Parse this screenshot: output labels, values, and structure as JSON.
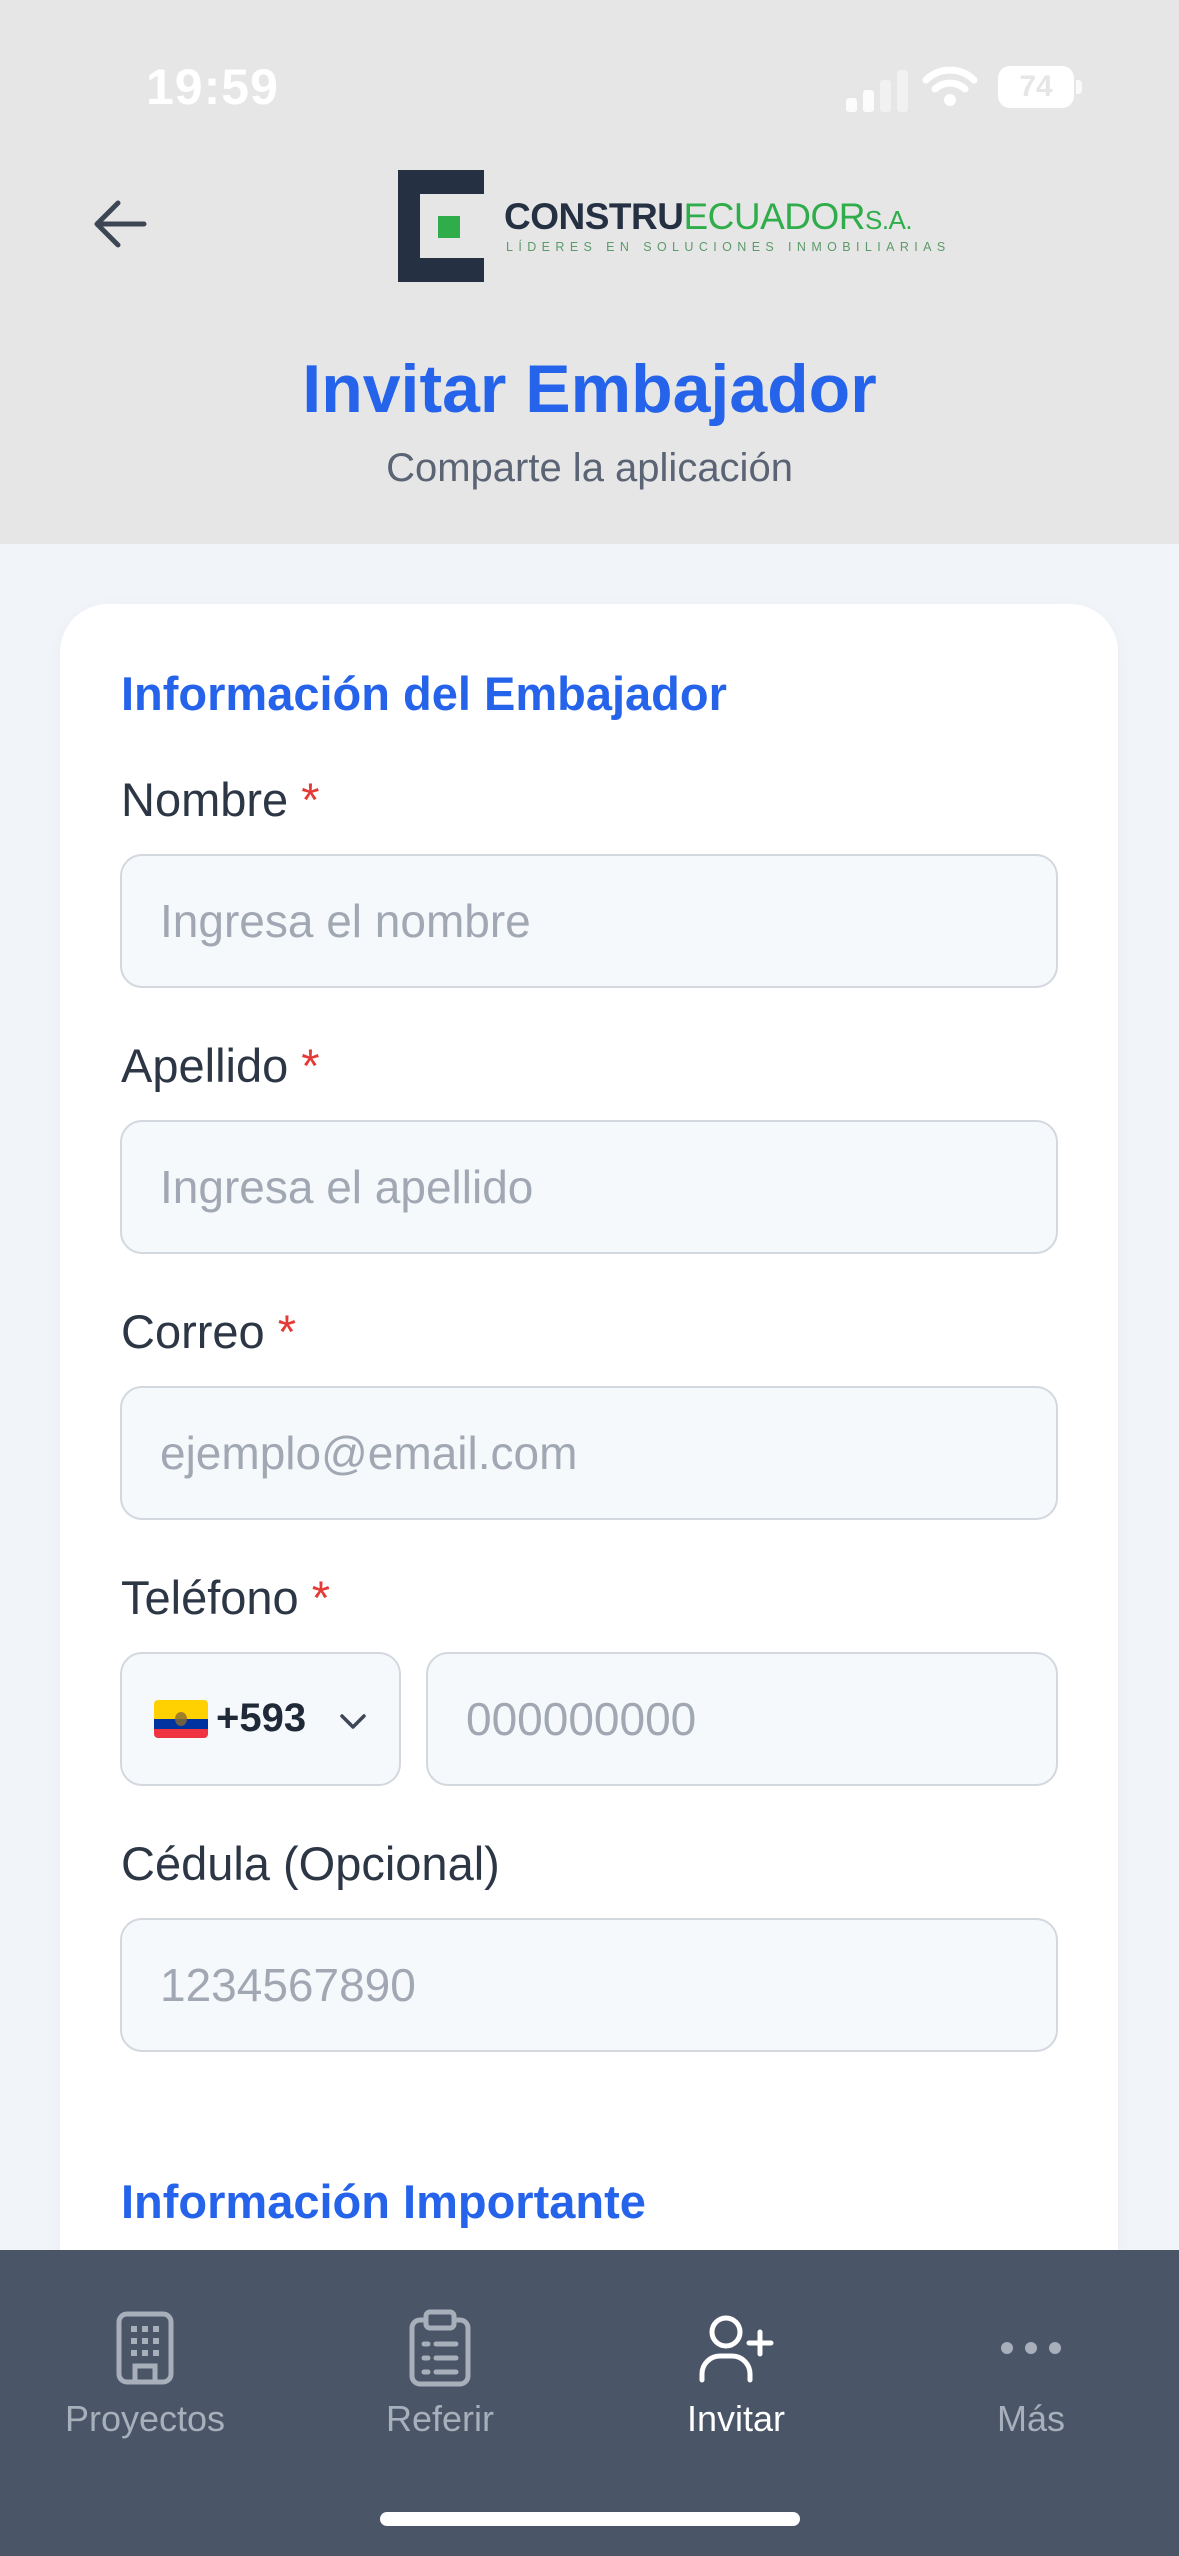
{
  "status_bar": {
    "time": "19:59",
    "battery": "74"
  },
  "header": {
    "back_icon": "arrow-left-icon",
    "logo": {
      "brand_part1": "CONSTRU",
      "brand_part2": "ECUADOR",
      "brand_part3": "S.A.",
      "tagline": "LÍDERES EN SOLUCIONES INMOBILIARIAS"
    },
    "title": "Invitar Embajador",
    "subtitle": "Comparte la aplicación"
  },
  "form": {
    "section_title": "Información del Embajador",
    "required_mark": "*",
    "nombre": {
      "label": "Nombre",
      "placeholder": "Ingresa el nombre",
      "value": ""
    },
    "apellido": {
      "label": "Apellido",
      "placeholder": "Ingresa el apellido",
      "value": ""
    },
    "correo": {
      "label": "Correo",
      "placeholder": "ejemplo@email.com",
      "value": ""
    },
    "telefono": {
      "label": "Teléfono",
      "country_code": "+593",
      "flag": "ecuador-flag-icon",
      "placeholder": "000000000",
      "value": ""
    },
    "cedula": {
      "label": "Cédula (Opcional)",
      "placeholder": "1234567890",
      "value": ""
    },
    "info_section_title": "Información Importante"
  },
  "tabbar": {
    "active": "Invitar",
    "items": [
      {
        "label": "Proyectos",
        "icon": "building-icon"
      },
      {
        "label": "Referir",
        "icon": "clipboard-icon"
      },
      {
        "label": "Invitar",
        "icon": "user-plus-icon"
      },
      {
        "label": "Más",
        "icon": "more-horizontal-icon"
      }
    ]
  },
  "colors": {
    "accent": "#2563eb",
    "required": "#e53935",
    "tabbar_bg": "#4a5567",
    "brand_green": "#2ead4a",
    "brand_dark": "#253142"
  }
}
